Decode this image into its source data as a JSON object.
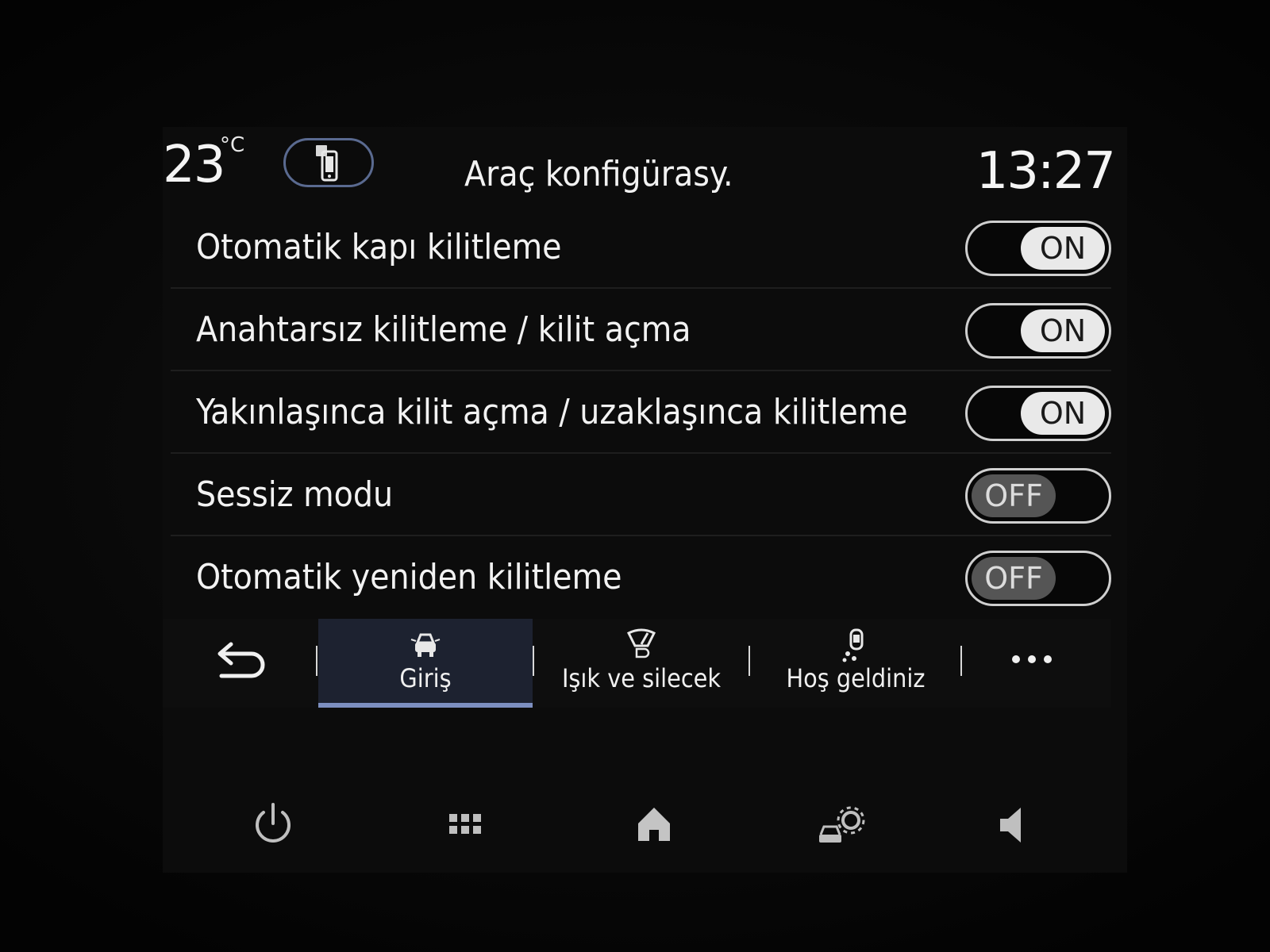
{
  "status_bar": {
    "temperature": "23",
    "temperature_unit": "°C",
    "title": "Araç konfigürasy.",
    "time": "13:27",
    "phone_icon": "phone-mirror-icon"
  },
  "settings": [
    {
      "label": "Otomatik kapı kilitleme",
      "state": "ON"
    },
    {
      "label": "Anahtarsız kilitleme / kilit açma",
      "state": "ON"
    },
    {
      "label": "Yakınlaşınca kilit açma / uzaklaşınca kilitleme",
      "state": "ON"
    },
    {
      "label": "Sessiz modu",
      "state": "OFF"
    },
    {
      "label": "Otomatik yeniden kilitleme",
      "state": "OFF"
    }
  ],
  "tabs": [
    {
      "label": "Giriş",
      "icon": "car-access-icon",
      "active": true
    },
    {
      "label": "Işık ve silecek",
      "icon": "wiper-light-icon",
      "active": false
    },
    {
      "label": "Hoş geldiniz",
      "icon": "welcome-icon",
      "active": false
    }
  ],
  "tabbar_icons": {
    "back": "back-arrow-icon",
    "more": "more-dots-icon"
  },
  "system_bar": [
    "power-icon",
    "apps-grid-icon",
    "home-icon",
    "vehicle-settings-icon",
    "volume-icon"
  ],
  "colors": {
    "accent": "#7d8fc0",
    "active_tab_bg": "#1d2230",
    "toggle_on_knob": "#e9e9e9",
    "toggle_off_knob": "#555555"
  }
}
